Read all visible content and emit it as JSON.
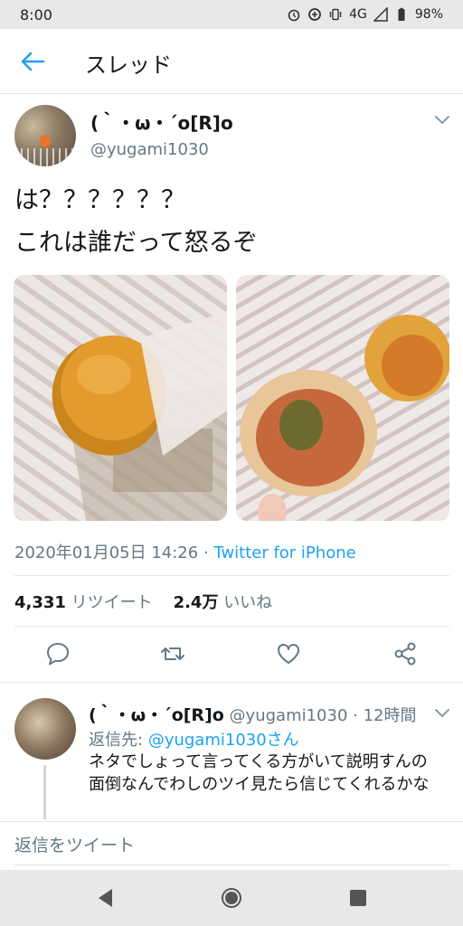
{
  "status_bar": {
    "time": "8:00",
    "network": "4G",
    "battery": "98%"
  },
  "app_bar": {
    "title": "スレッド"
  },
  "tweet": {
    "display_name": "(｀・ω・´o[R]o",
    "handle": "@yugami1030",
    "text_line1": "は？？？？？？",
    "text_line2": "これは誰だって怒るぞ",
    "timestamp": "2020年01月05日 14:26",
    "source": "Twitter for iPhone",
    "retweet_count": "4,331",
    "retweet_label": "リツイート",
    "like_count": "2.4万",
    "like_label": "いいね"
  },
  "reply": {
    "display_name": "(｀・ω・´o[R]o",
    "handle": "@yugami1030",
    "time": "· 12時間",
    "reply_to_prefix": "返信先:",
    "reply_to_link": "@yugami1030さん",
    "text": "ネタでしょって言ってくる方がいて説明すんの面倒なんでわしのツイ見たら信じてくれるかな"
  },
  "compose": {
    "placeholder": "返信をツイート"
  },
  "colors": {
    "accent": "#1da1f2",
    "secondary_text": "#657786",
    "divider": "#e1e8ed"
  },
  "icons": {
    "back": "arrow-left-icon",
    "caret": "chevron-down-icon",
    "reply": "comment-icon",
    "retweet": "retweet-icon",
    "like": "heart-icon",
    "share": "share-icon"
  }
}
